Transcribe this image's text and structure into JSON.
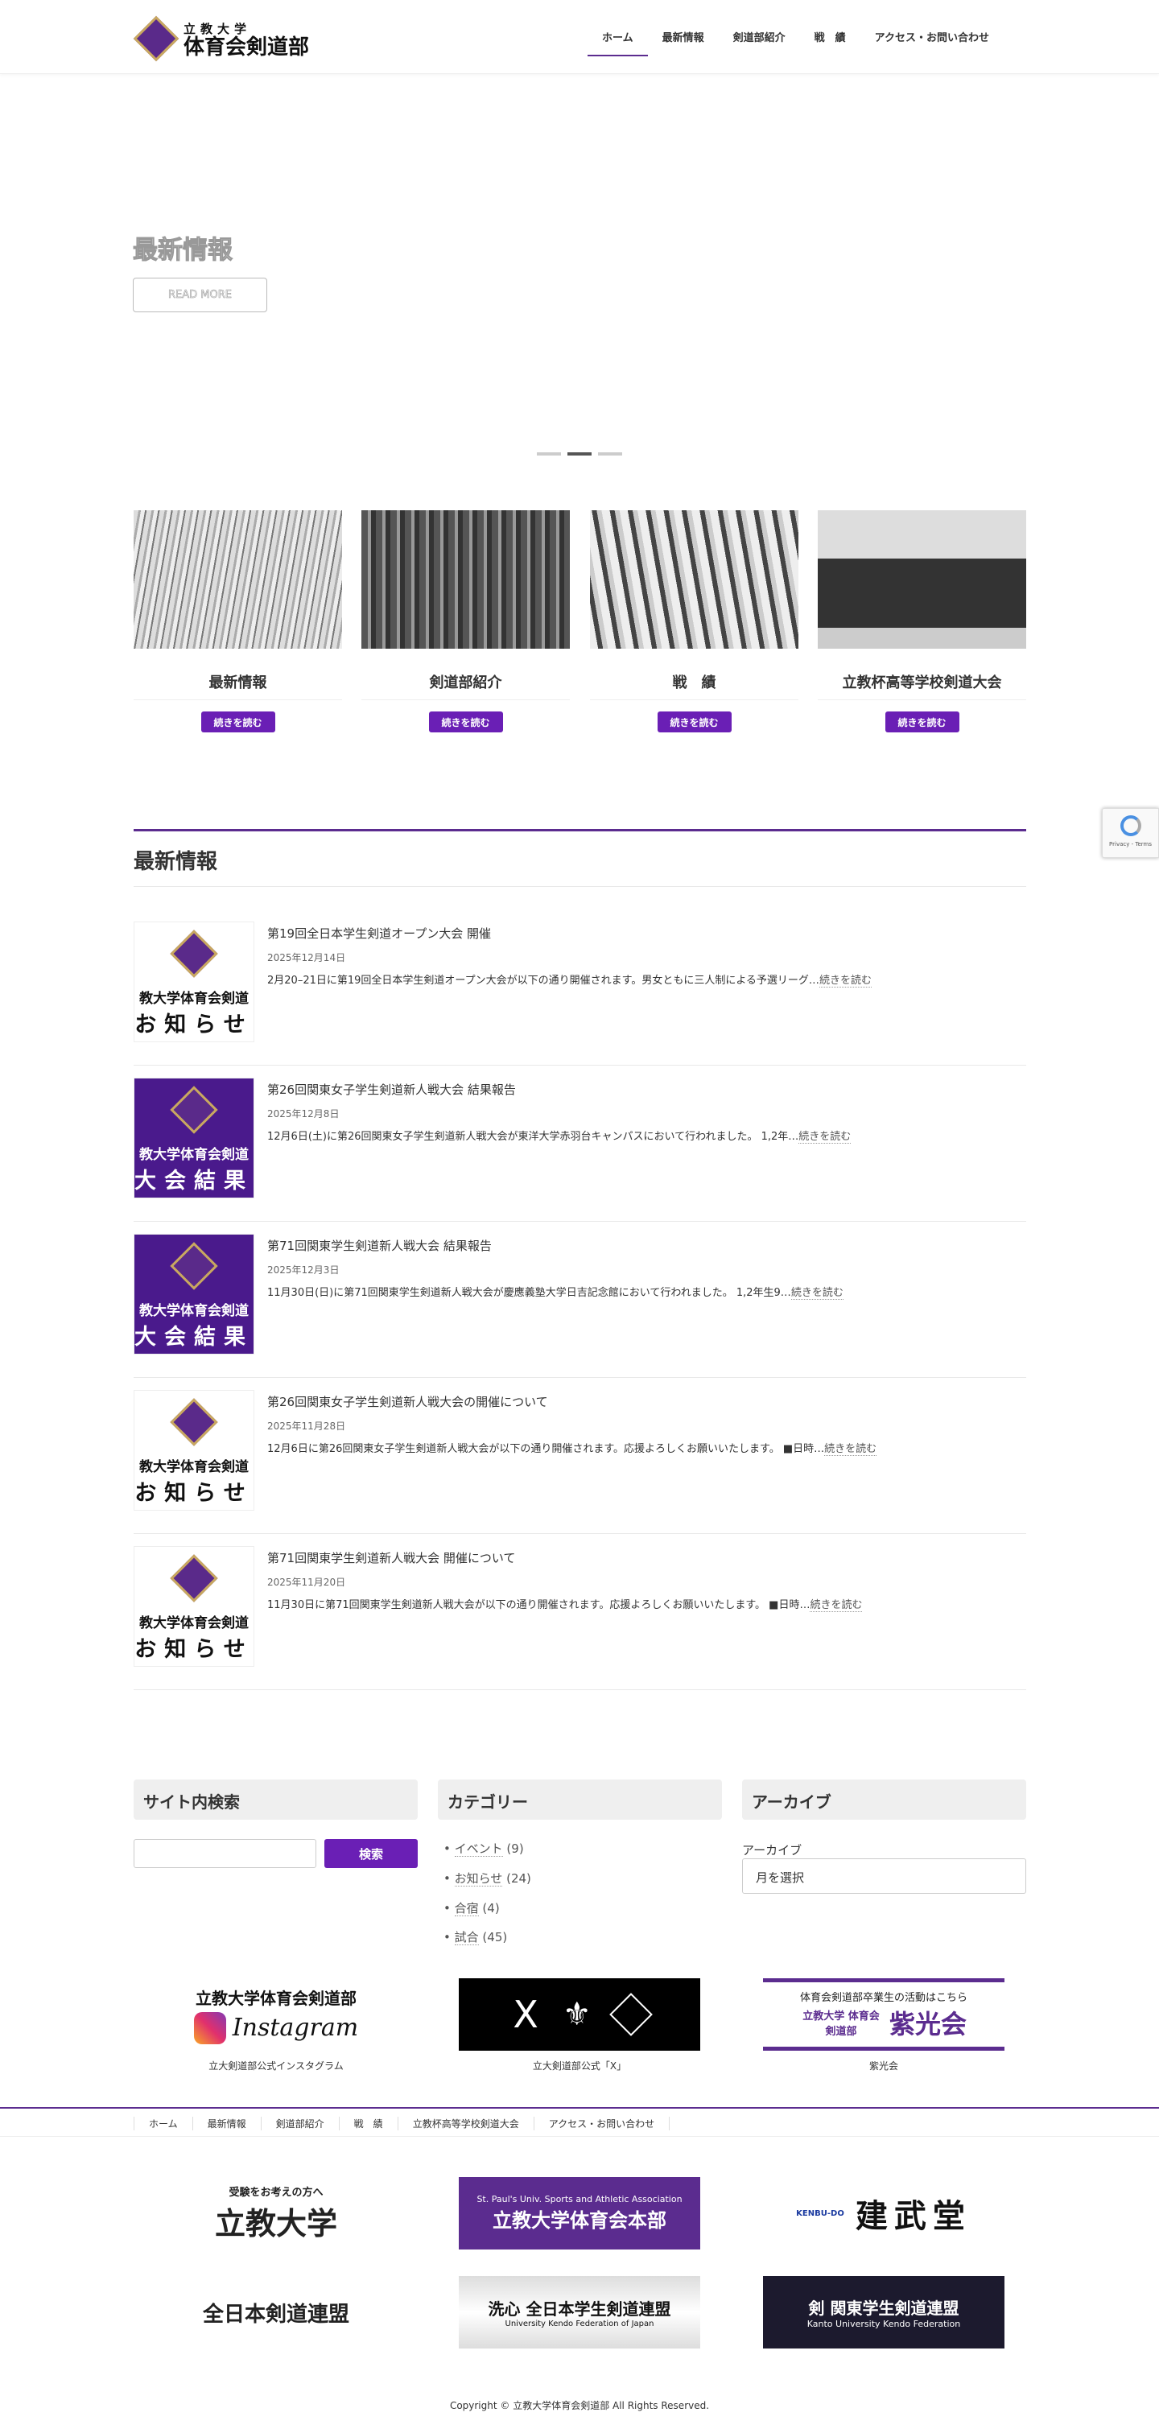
{
  "header": {
    "logo_line1": "立教大学",
    "logo_line2": "体育会剣道部",
    "nav": [
      {
        "label": "ホーム",
        "active": true
      },
      {
        "label": "最新情報"
      },
      {
        "label": "剣道部紹介"
      },
      {
        "label": "戦　績"
      },
      {
        "label": "アクセス・お問い合わせ"
      }
    ]
  },
  "hero": {
    "title": "最新情報",
    "button": "READ MORE",
    "slides": 3,
    "active_slide": 2
  },
  "cards": [
    {
      "title": "最新情報",
      "button": "続きを読む"
    },
    {
      "title": "剣道部紹介",
      "button": "続きを読む"
    },
    {
      "title": "戦　績",
      "button": "続きを読む"
    },
    {
      "title": "立教杯高等学校剣道大会",
      "button": "続きを読む"
    }
  ],
  "news": {
    "heading": "最新情報",
    "read_more": "続きを読む",
    "posts": [
      {
        "title": "第19回全日本学生剣道オープン大会 開催",
        "date": "2025年12月14日",
        "excerpt": "2月20–21日に第19回全日本学生剣道オープン大会が以下の通り開催されます。男女ともに三人制による予選リーグ…",
        "thumb_line1": "教大学体育会剣道",
        "thumb_line2": "お知らせ",
        "thumb_style": "white"
      },
      {
        "title": "第26回関東女子学生剣道新人戦大会 結果報告",
        "date": "2025年12月8日",
        "excerpt": "12月6日(土)に第26回関東女子学生剣道新人戦大会が東洋大学赤羽台キャンパスにおいて行われました。 1,2年…",
        "thumb_line1": "教大学体育会剣道",
        "thumb_line2": "大会結果",
        "thumb_style": "purple"
      },
      {
        "title": "第71回関東学生剣道新人戦大会 結果報告",
        "date": "2025年12月3日",
        "excerpt": "11月30日(日)に第71回関東学生剣道新人戦大会が慶應義塾大学日吉記念館において行われました。 1,2年生9…",
        "thumb_line1": "教大学体育会剣道",
        "thumb_line2": "大会結果",
        "thumb_style": "purple"
      },
      {
        "title": "第26回関東女子学生剣道新人戦大会の開催について",
        "date": "2025年11月28日",
        "excerpt": "12月6日に第26回関東女子学生剣道新人戦大会が以下の通り開催されます。応援よろしくお願いいたします。 ■日時…",
        "thumb_line1": "教大学体育会剣道",
        "thumb_line2": "お知らせ",
        "thumb_style": "white"
      },
      {
        "title": "第71回関東学生剣道新人戦大会 開催について",
        "date": "2025年11月20日",
        "excerpt": "11月30日に第71回関東学生剣道新人戦大会が以下の通り開催されます。応援よろしくお願いいたします。 ■日時…",
        "thumb_line1": "教大学体育会剣道",
        "thumb_line2": "お知らせ",
        "thumb_style": "white"
      }
    ]
  },
  "widgets": {
    "search": {
      "heading": "サイト内検索",
      "value": "",
      "button": "検索"
    },
    "categories": {
      "heading": "カテゴリー",
      "items": [
        {
          "label": "イベント",
          "count": "(9)"
        },
        {
          "label": "お知らせ",
          "count": "(24)"
        },
        {
          "label": "合宿",
          "count": "(4)"
        },
        {
          "label": "試合",
          "count": "(45)"
        }
      ]
    },
    "archive": {
      "heading": "アーカイブ",
      "label": "アーカイブ",
      "select": "月を選択"
    }
  },
  "banners": [
    {
      "caption": "立大剣道部公式インスタグラム",
      "text1": "立教大学体育会剣道部",
      "text2": "Instagram"
    },
    {
      "caption": "立大剣道部公式「X」",
      "text1": "X"
    },
    {
      "caption": "紫光会",
      "text1": "体育会剣道部卒業生の活動はこちら",
      "text2": "立教大学 体育会剣道部",
      "text3": "紫光会"
    }
  ],
  "footer_nav": [
    "ホーム",
    "最新情報",
    "剣道部紹介",
    "戦　績",
    "立教杯高等学校剣道大会",
    "アクセス・お問い合わせ"
  ],
  "partner_logos": [
    {
      "line1": "受験をお考えの方へ",
      "line2": "立教大学"
    },
    {
      "line1": "St. Paul's Univ. Sports and Athletic Association",
      "line2": "立教大学体育会本部"
    },
    {
      "line1": "KENBU-DO",
      "line2": "建武堂"
    },
    {
      "line1": "全日本剣道連盟"
    },
    {
      "line1": "洗心 全日本学生剣道連盟",
      "line2": "University Kendo Federation of Japan"
    },
    {
      "line1": "剣 関東学生剣道連盟",
      "line2": "Kanto University Kendo Federation"
    }
  ],
  "copyright": "Copyright © 立教大学体育会剣道部 All Rights Reserved.",
  "recaptcha": {
    "text": "Privacy - Terms"
  },
  "colors": {
    "accent": "#5b2c8f",
    "button": "#6a1fb5"
  }
}
